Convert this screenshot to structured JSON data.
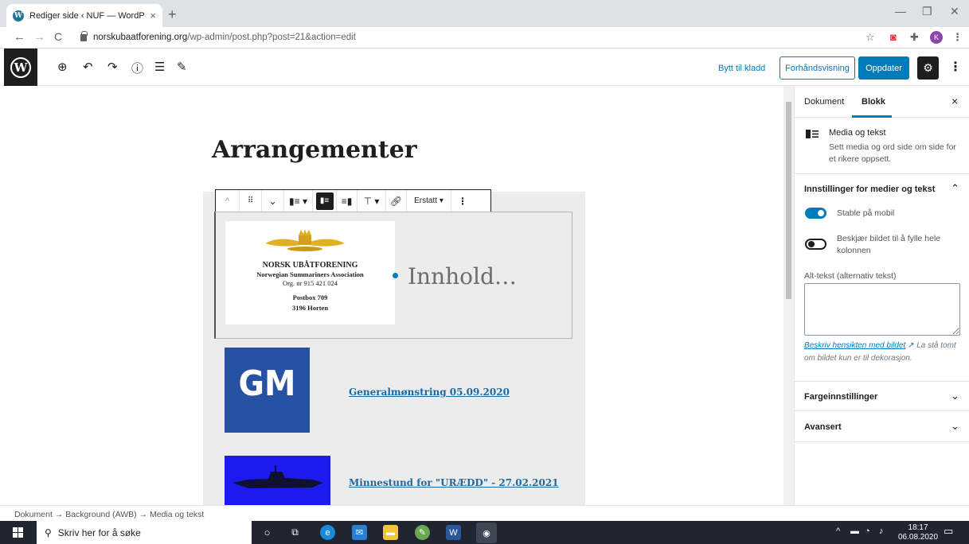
{
  "browser": {
    "tab_title": "Rediger side ‹ NUF — WordPress",
    "tab_close": "×",
    "new_tab": "+",
    "url_host": "norskubaatforening.org",
    "url_path": "/wp-admin/post.php?post=21&action=edit",
    "profile_initial": "K"
  },
  "wp_toolbar": {
    "switch_to_draft": "Bytt til kladd",
    "preview": "Forhåndsvisning",
    "update": "Oppdater"
  },
  "editor": {
    "post_title": "Arrangementer",
    "block_toolbar": {
      "replace_label": "Erstatt"
    },
    "media_card": {
      "line1": "NORSK UBÅTFORENING",
      "line2": "Norwegian Summariners Association",
      "line3": "Org. nr 915 421 024",
      "line4": "Postbox  709",
      "line5": "3196 Horten"
    },
    "content_placeholder": "Innhold…",
    "gm_tile_text": "GM",
    "link1": "Generalmønstring 05.09.2020",
    "link2": "Minnestund for \"URÆDD\" - 27.02.2021"
  },
  "sidebar": {
    "tab_document": "Dokument",
    "tab_block": "Blokk",
    "close": "×",
    "block_name": "Media og tekst",
    "block_desc": "Sett media og ord side om side for et rikere oppsett.",
    "panel_media_settings": "Innstillinger for medier og tekst",
    "toggle_stack": "Stable på mobil",
    "toggle_stack_on": true,
    "toggle_crop": "Beskjær bildet til å fylle hele kolonnen",
    "toggle_crop_on": false,
    "alt_label": "Alt-tekst (alternativ tekst)",
    "alt_value": "",
    "alt_help_link": "Beskriv hensikten med bildet",
    "alt_help_rest": "La stå tomt om bildet kun er til dekorasjon.",
    "panel_colors": "Fargeinnstillinger",
    "panel_advanced": "Avansert",
    "accent_color": "#007cba"
  },
  "breadcrumb": {
    "items": [
      "Dokument",
      "Background (AWB)",
      "Media og tekst"
    ],
    "separator": "→"
  },
  "taskbar": {
    "search_placeholder": "Skriv her for å søke",
    "time": "18:17",
    "date": "06.08.2020"
  }
}
